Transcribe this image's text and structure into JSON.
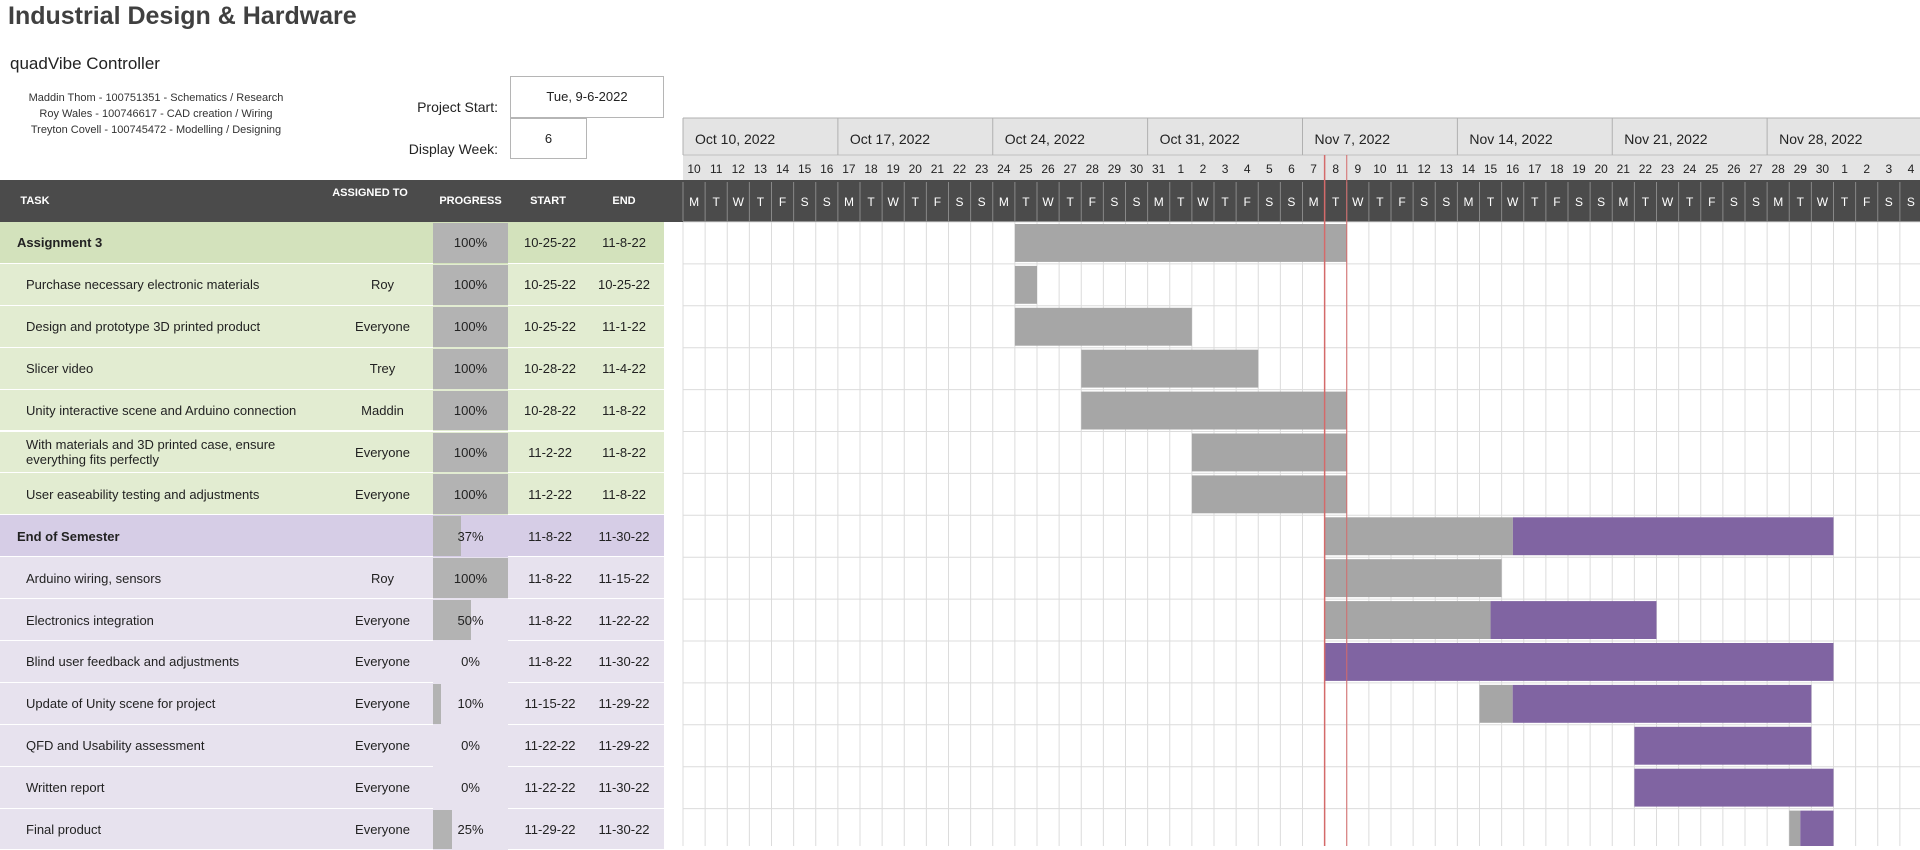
{
  "header": {
    "title": "Industrial Design & Hardware",
    "project_name": "quadVibe Controller",
    "team": [
      "Maddin Thom - 100751351 - Schematics / Research",
      "Roy Wales - 100746617 - CAD creation / Wiring",
      "Treyton Covell - 100745472 - Modelling / Designing"
    ],
    "project_start_label": "Project Start:",
    "project_start_value": "Tue, 9-6-2022",
    "display_week_label": "Display Week:",
    "display_week_value": "6"
  },
  "table": {
    "columns": {
      "task": "TASK",
      "assigned": "ASSIGNED TO",
      "progress": "PROGRESS",
      "start": "START",
      "end": "END"
    }
  },
  "colors": {
    "group1_bg": "#e2ecd1",
    "group1_header": "#d3e2bc",
    "group2_bg": "#e7e2ee",
    "group2_header": "#d6cde6",
    "bar_done": "#a6a6a6",
    "bar_remaining": "#8064a2",
    "today_line": "#d46a6a",
    "header_bg": "#4b4b4b"
  },
  "chart_data": {
    "type": "gantt",
    "timeline_start": "2022-10-10",
    "timeline_days": 56,
    "today": "2022-11-08",
    "weeks": [
      "Oct 10, 2022",
      "Oct 17, 2022",
      "Oct 24, 2022",
      "Oct 31, 2022",
      "Nov 7, 2022",
      "Nov 14, 2022",
      "Nov 21, 2022",
      "Nov 28, 2022"
    ],
    "day_numbers": [
      10,
      11,
      12,
      13,
      14,
      15,
      16,
      17,
      18,
      19,
      20,
      21,
      22,
      23,
      24,
      25,
      26,
      27,
      28,
      29,
      30,
      31,
      1,
      2,
      3,
      4,
      5,
      6,
      7,
      8,
      9,
      10,
      11,
      12,
      13,
      14,
      15,
      16,
      17,
      18,
      19,
      20,
      21,
      22,
      23,
      24,
      25,
      26,
      27,
      28,
      29,
      30,
      1,
      2,
      3,
      4
    ],
    "weekday_letters": [
      "M",
      "T",
      "W",
      "T",
      "F",
      "S",
      "S"
    ],
    "groups": [
      {
        "name": "Assignment 3",
        "progress": "100%",
        "progress_value": 1.0,
        "start": "10-25-22",
        "end": "11-8-22",
        "tasks": [
          {
            "task": "Purchase necessary electronic materials",
            "assigned": "Roy",
            "progress": "100%",
            "progress_value": 1.0,
            "start": "10-25-22",
            "end": "10-25-22"
          },
          {
            "task": "Design and prototype 3D printed product",
            "assigned": "Everyone",
            "progress": "100%",
            "progress_value": 1.0,
            "start": "10-25-22",
            "end": "11-1-22"
          },
          {
            "task": "Slicer video",
            "assigned": "Trey",
            "progress": "100%",
            "progress_value": 1.0,
            "start": "10-28-22",
            "end": "11-4-22"
          },
          {
            "task": "Unity interactive scene and Arduino connection",
            "assigned": "Maddin",
            "progress": "100%",
            "progress_value": 1.0,
            "start": "10-28-22",
            "end": "11-8-22"
          },
          {
            "task": "With materials and 3D printed case, ensure everything fits perfectly",
            "assigned": "Everyone",
            "progress": "100%",
            "progress_value": 1.0,
            "start": "11-2-22",
            "end": "11-8-22"
          },
          {
            "task": "User easeability testing and adjustments",
            "assigned": "Everyone",
            "progress": "100%",
            "progress_value": 1.0,
            "start": "11-2-22",
            "end": "11-8-22"
          }
        ]
      },
      {
        "name": "End of Semester",
        "progress": "37%",
        "progress_value": 0.37,
        "start": "11-8-22",
        "end": "11-30-22",
        "tasks": [
          {
            "task": "Arduino wiring, sensors",
            "assigned": "Roy",
            "progress": "100%",
            "progress_value": 1.0,
            "start": "11-8-22",
            "end": "11-15-22"
          },
          {
            "task": "Electronics integration",
            "assigned": "Everyone",
            "progress": "50%",
            "progress_value": 0.5,
            "start": "11-8-22",
            "end": "11-22-22"
          },
          {
            "task": "Blind user feedback and adjustments",
            "assigned": "Everyone",
            "progress": "0%",
            "progress_value": 0.0,
            "start": "11-8-22",
            "end": "11-30-22"
          },
          {
            "task": "Update of Unity scene for project",
            "assigned": "Everyone",
            "progress": "10%",
            "progress_value": 0.1,
            "start": "11-15-22",
            "end": "11-29-22"
          },
          {
            "task": "QFD and Usability assessment",
            "assigned": "Everyone",
            "progress": "0%",
            "progress_value": 0.0,
            "start": "11-22-22",
            "end": "11-29-22"
          },
          {
            "task": "Written report",
            "assigned": "Everyone",
            "progress": "0%",
            "progress_value": 0.0,
            "start": "11-22-22",
            "end": "11-30-22"
          },
          {
            "task": "Final product",
            "assigned": "Everyone",
            "progress": "25%",
            "progress_value": 0.25,
            "start": "11-29-22",
            "end": "11-30-22"
          }
        ]
      }
    ]
  }
}
